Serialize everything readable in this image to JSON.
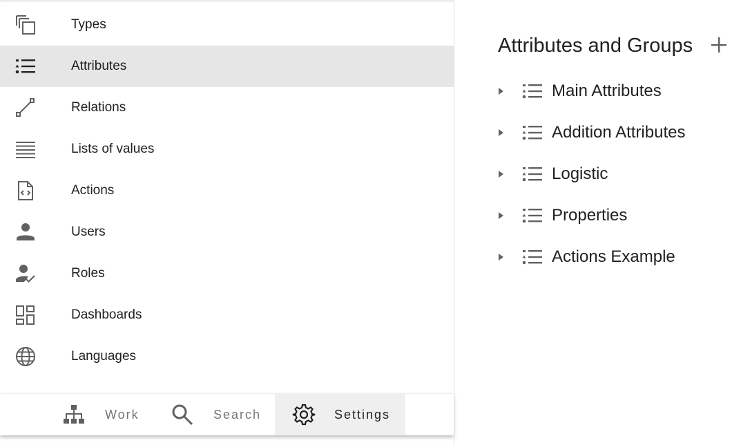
{
  "nav": {
    "items": [
      {
        "label": "Types",
        "icon": "copy-icon"
      },
      {
        "label": "Attributes",
        "icon": "list-icon",
        "active": true
      },
      {
        "label": "Relations",
        "icon": "relation-icon"
      },
      {
        "label": "Lists of values",
        "icon": "lines-icon"
      },
      {
        "label": "Actions",
        "icon": "code-file-icon"
      },
      {
        "label": "Users",
        "icon": "person-icon"
      },
      {
        "label": "Roles",
        "icon": "person-check-icon"
      },
      {
        "label": "Dashboards",
        "icon": "dashboard-icon"
      },
      {
        "label": "Languages",
        "icon": "globe-icon"
      }
    ]
  },
  "bottom_nav": {
    "work_label": "Work",
    "search_label": "Search",
    "settings_label": "Settings",
    "active": "Settings"
  },
  "panel": {
    "title": "Attributes and Groups",
    "add_icon": "plus-icon",
    "groups": [
      {
        "label": "Main Attributes"
      },
      {
        "label": "Addition Attributes"
      },
      {
        "label": "Logistic"
      },
      {
        "label": "Properties"
      },
      {
        "label": "Actions Example"
      }
    ]
  },
  "colors": {
    "active_background": "#e6e6e6",
    "icon": "#616161",
    "text": "#212121",
    "muted_text": "#757575"
  }
}
